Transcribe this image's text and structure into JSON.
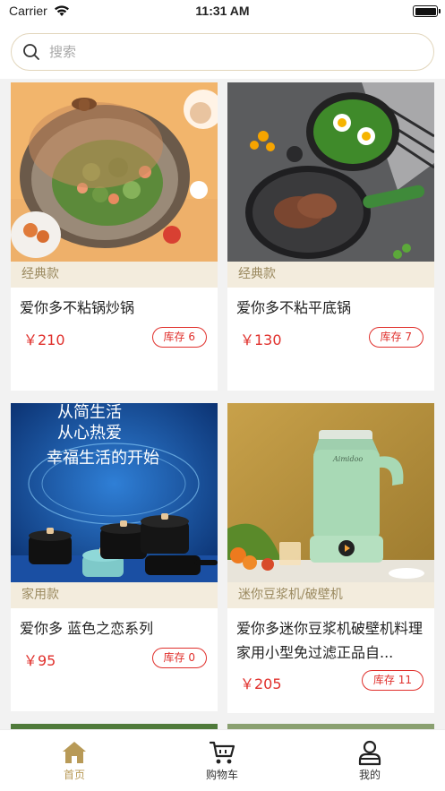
{
  "status_bar": {
    "carrier": "Carrier",
    "time": "11:31 AM"
  },
  "search": {
    "placeholder": "搜索"
  },
  "products": [
    {
      "category": "经典款",
      "name": "爱你多不粘锅炒锅",
      "price": "￥210",
      "stock": "库存 6",
      "image": "wok-with-vegetables-photo"
    },
    {
      "category": "经典款",
      "name": "爱你多不粘平底锅",
      "price": "￥130",
      "stock": "库存 7",
      "image": "frying-pan-with-steak-photo"
    },
    {
      "category": "家用款",
      "name": "爱你多  蓝色之恋系列",
      "price": "￥95",
      "stock": "库存 0",
      "image": "casserole-set-banner-photo",
      "banner_lines": [
        "从简生活",
        "从心热爱",
        "幸福生活的开始"
      ]
    },
    {
      "category": "迷你豆浆机/破壁机",
      "name": "爱你多迷你豆浆机破壁机料理家用小型免过滤正品自...",
      "price": "￥205",
      "stock": "库存 11",
      "image": "soymilk-blender-photo",
      "brand_text": "Aimidoo"
    }
  ],
  "tabbar": {
    "items": [
      {
        "label": "首页",
        "icon": "home-icon",
        "active": true
      },
      {
        "label": "购物车",
        "icon": "cart-icon",
        "active": false
      },
      {
        "label": "我的",
        "icon": "user-icon",
        "active": false
      }
    ]
  },
  "colors": {
    "accent": "#b89a57",
    "price": "#e0302c",
    "category_bg": "#f3ecdd",
    "category_text": "#9b8a60",
    "search_border": "#e2d6bc"
  }
}
